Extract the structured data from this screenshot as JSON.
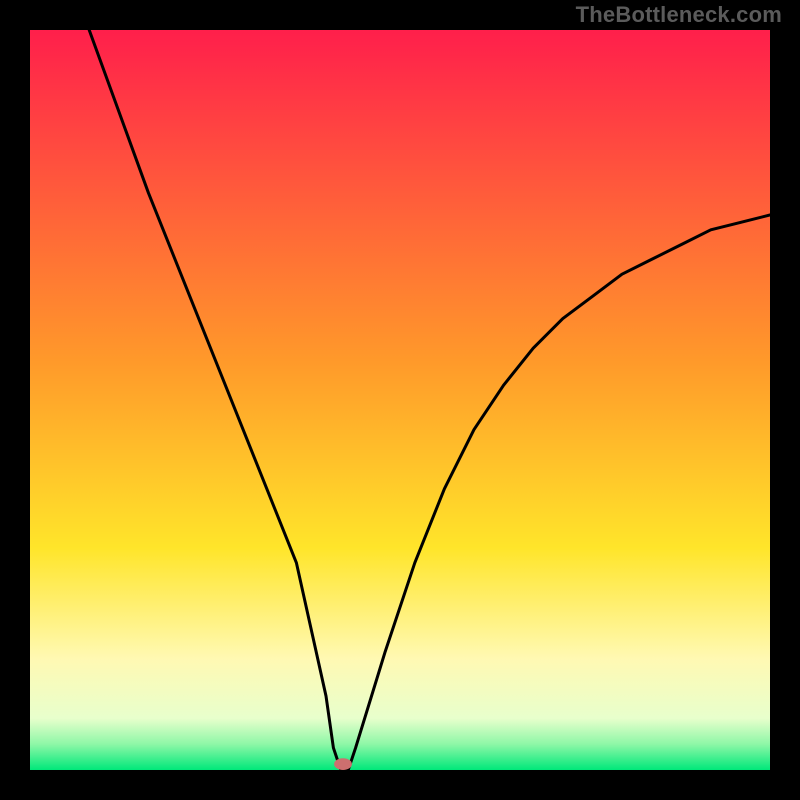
{
  "watermark": "TheBottleneck.com",
  "chart_data": {
    "type": "line",
    "title": "",
    "xlabel": "",
    "ylabel": "",
    "xlim": [
      0,
      100
    ],
    "ylim": [
      0,
      100
    ],
    "grid": false,
    "legend": false,
    "gradient_bands": [
      {
        "stop": 0.0,
        "color": "#ff1f4b"
      },
      {
        "stop": 0.45,
        "color": "#ff9a2a"
      },
      {
        "stop": 0.7,
        "color": "#ffe52a"
      },
      {
        "stop": 0.85,
        "color": "#fff9b3"
      },
      {
        "stop": 0.93,
        "color": "#e8ffcc"
      },
      {
        "stop": 0.965,
        "color": "#8ef7a7"
      },
      {
        "stop": 1.0,
        "color": "#00e87a"
      }
    ],
    "series": [
      {
        "name": "bottleneck-curve",
        "color": "#000000",
        "x": [
          8,
          12,
          16,
          20,
          24,
          28,
          32,
          36,
          40,
          41,
          42,
          43,
          44,
          48,
          52,
          56,
          60,
          64,
          68,
          72,
          76,
          80,
          84,
          88,
          92,
          96,
          100
        ],
        "y": [
          100,
          89,
          78,
          68,
          58,
          48,
          38,
          28,
          10,
          3,
          0,
          0,
          3,
          16,
          28,
          38,
          46,
          52,
          57,
          61,
          64,
          67,
          69,
          71,
          73,
          74,
          75
        ]
      }
    ],
    "marker": {
      "name": "optimal-point",
      "x": 42.3,
      "y": 0.8,
      "color": "#cd6f6f",
      "rx": 1.2,
      "ry": 0.8
    }
  }
}
